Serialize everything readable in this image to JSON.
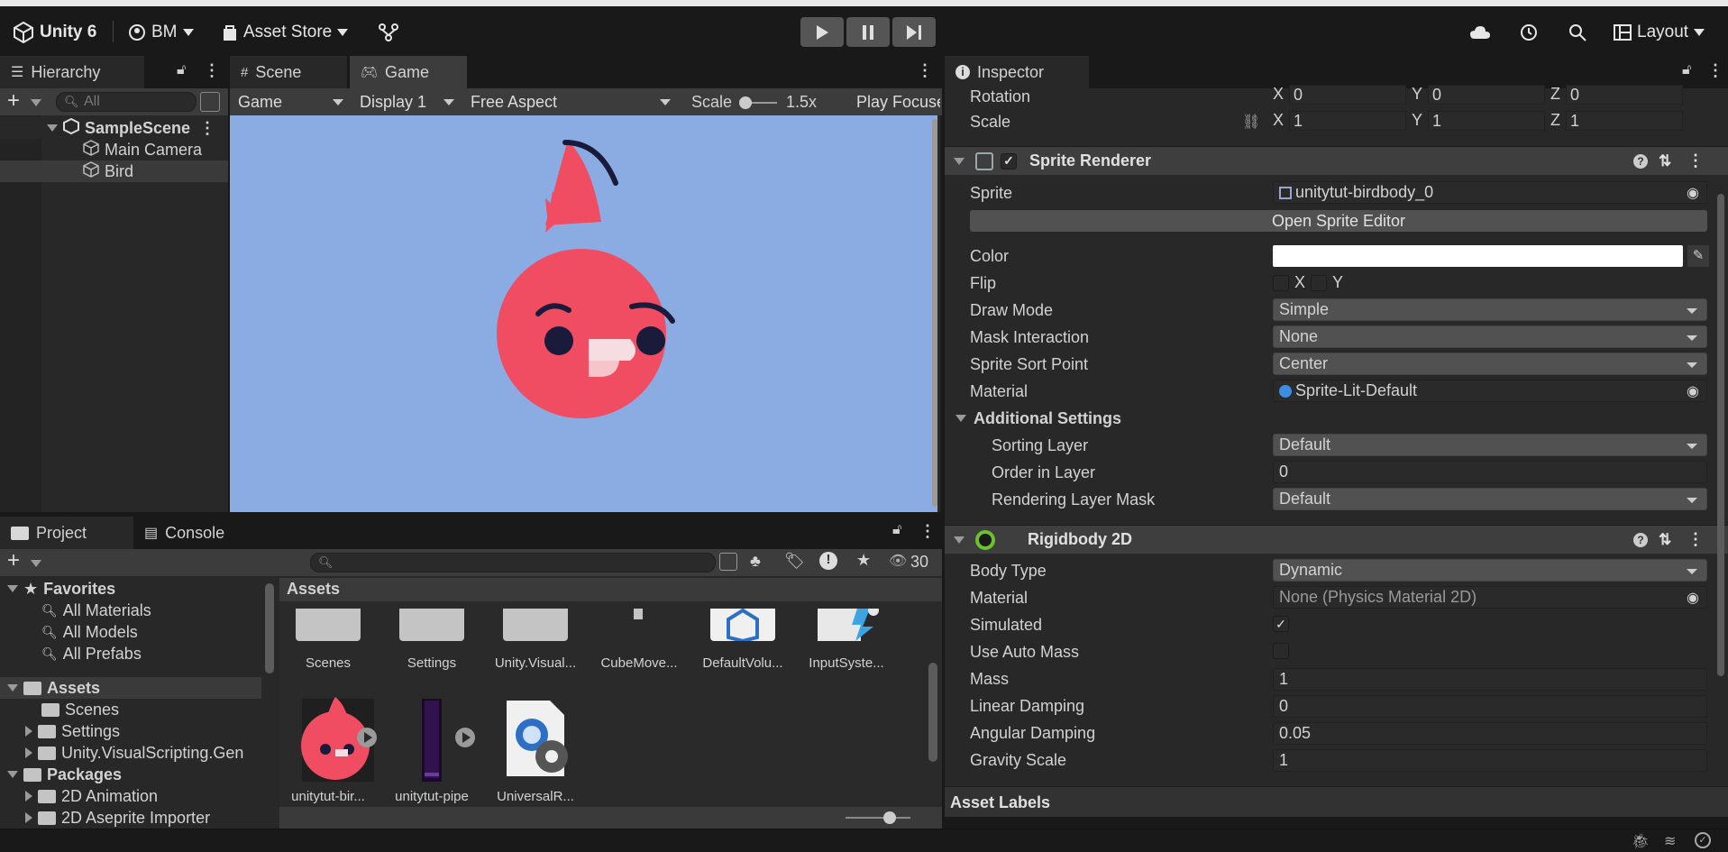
{
  "topbar": {
    "app_name": "Unity 6",
    "account": "BM",
    "asset_store": "Asset Store",
    "layout": "Layout"
  },
  "hierarchy": {
    "tab": "Hierarchy",
    "search_placeholder": "All",
    "scene": "SampleScene",
    "items": [
      "Main Camera",
      "Bird"
    ]
  },
  "scene_tabs": {
    "scene": "Scene",
    "game": "Game"
  },
  "game_toolbar": {
    "mode": "Game",
    "display": "Display 1",
    "aspect": "Free Aspect",
    "scale_label": "Scale",
    "scale_value": "1.5x",
    "play_focused": "Play Focuse"
  },
  "project": {
    "tab_project": "Project",
    "tab_console": "Console",
    "hidden_count": "30",
    "assets_header": "Assets",
    "favorites": "Favorites",
    "fav_items": [
      "All Materials",
      "All Models",
      "All Prefabs"
    ],
    "assets": "Assets",
    "asset_folders": [
      "Scenes",
      "Settings",
      "Unity.VisualScripting.Gen"
    ],
    "packages": "Packages",
    "package_folders": [
      "2D Animation",
      "2D Aseprite Importer"
    ],
    "grid_row1": [
      "Scenes",
      "Settings",
      "Unity.Visual...",
      "CubeMove...",
      "DefaultVolu...",
      "InputSyste..."
    ],
    "grid_row2": [
      "unitytut-bir...",
      "unitytut-pipe",
      "UniversalR..."
    ]
  },
  "inspector": {
    "tab": "Inspector",
    "transform": {
      "rotation_label": "Rotation",
      "rotation": {
        "x": "0",
        "y": "0",
        "z": "0"
      },
      "scale_label": "Scale",
      "scale": {
        "x": "1",
        "y": "1",
        "z": "1"
      }
    },
    "sprite_renderer": {
      "title": "Sprite Renderer",
      "sprite_label": "Sprite",
      "sprite": "unitytut-birdbody_0",
      "open_editor": "Open Sprite Editor",
      "color_label": "Color",
      "color_value": "#ffffff",
      "flip_label": "Flip",
      "flip_x": "X",
      "flip_y": "Y",
      "draw_mode_label": "Draw Mode",
      "draw_mode": "Simple",
      "mask_label": "Mask Interaction",
      "mask": "None",
      "sort_point_label": "Sprite Sort Point",
      "sort_point": "Center",
      "material_label": "Material",
      "material": "Sprite-Lit-Default",
      "additional": "Additional Settings",
      "sorting_layer_label": "Sorting Layer",
      "sorting_layer": "Default",
      "order_label": "Order in Layer",
      "order": "0",
      "rendering_mask_label": "Rendering Layer Mask",
      "rendering_mask": "Default"
    },
    "rigidbody": {
      "title": "Rigidbody 2D",
      "body_type_label": "Body Type",
      "body_type": "Dynamic",
      "material_label": "Material",
      "material": "None (Physics Material 2D)",
      "simulated_label": "Simulated",
      "auto_mass_label": "Use Auto Mass",
      "mass_label": "Mass",
      "mass": "1",
      "linear_label": "Linear Damping",
      "linear": "0",
      "angular_label": "Angular Damping",
      "angular": "0.05",
      "gravity_label": "Gravity Scale",
      "gravity": "1"
    },
    "asset_labels": "Asset Labels"
  },
  "colors": {
    "game_bg": "#8aace3",
    "bird": "#f04d62",
    "accent": "#3d8de4"
  }
}
